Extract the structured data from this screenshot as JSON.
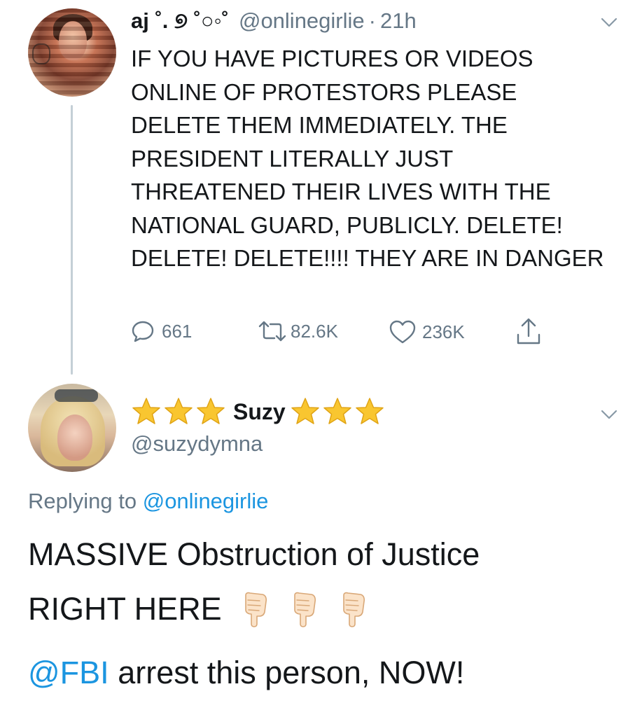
{
  "tweet1": {
    "display_name": "aj ˚. ୭ ˚○◦˚",
    "handle": "@onlinegirlie",
    "separator": "·",
    "time": "21h",
    "text": "IF YOU HAVE PICTURES OR VIDEOS ONLINE OF PROTESTORS PLEASE DELETE THEM IMMEDIATELY. THE PRESIDENT LITERALLY JUST THREATENED THEIR LIVES WITH THE NATIONAL GUARD, PUBLICLY. DELETE! DELETE! DELETE!!!! THEY ARE IN DANGER",
    "replies": "661",
    "retweets": "82.6K",
    "likes": "236K"
  },
  "tweet2": {
    "display_name": "Suzy",
    "handle": "@suzydymna",
    "replying_prefix": "Replying to",
    "replying_to": "@onlinegirlie",
    "line1": "MASSIVE Obstruction of Justice",
    "line2": "RIGHT HERE",
    "line3_mention": "@FBI",
    "line3_rest": " arrest this person, NOW!"
  },
  "icons": {
    "star_color": "#f9c630",
    "link_color": "#1b95e0",
    "muted_color": "#657786"
  }
}
